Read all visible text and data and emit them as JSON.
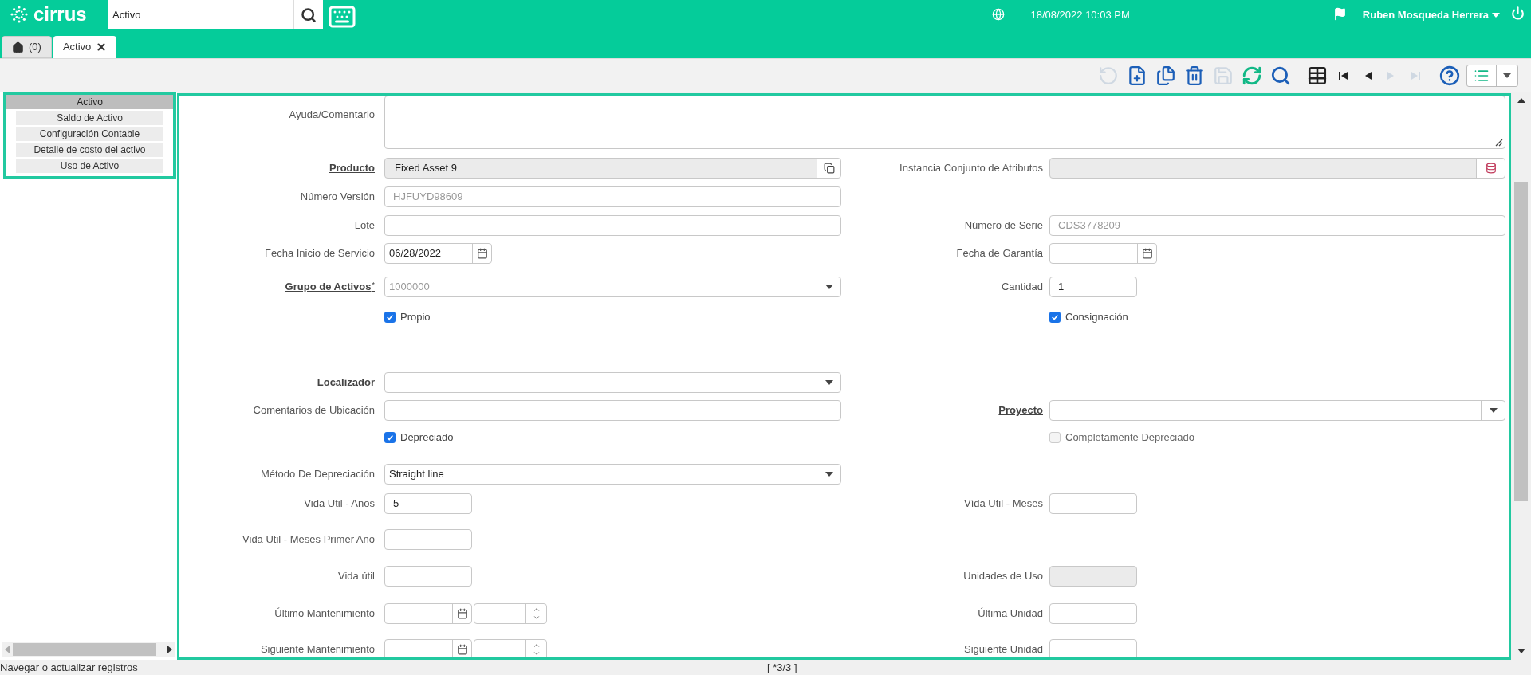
{
  "header": {
    "logo": "cirrus",
    "search": {
      "value": "Activo"
    },
    "datetime": "18/08/2022 10:03 PM",
    "user": "Ruben Mosqueda Herrera"
  },
  "tabs": [
    {
      "kind": "home",
      "label": "(0)",
      "selected": false
    },
    {
      "kind": "window",
      "label": "Activo",
      "selected": true
    }
  ],
  "toolbar": [
    {
      "kind": "undo",
      "disabled": true
    },
    {
      "kind": "new",
      "disabled": false
    },
    {
      "kind": "copy",
      "disabled": false
    },
    {
      "kind": "delete",
      "disabled": false
    },
    {
      "kind": "save",
      "disabled": true
    },
    {
      "kind": "refresh",
      "disabled": false
    },
    {
      "kind": "find",
      "disabled": false
    },
    {
      "kind": "grid",
      "disabled": false
    },
    {
      "kind": "first",
      "disabled": false
    },
    {
      "kind": "previous",
      "disabled": false
    },
    {
      "kind": "next",
      "disabled": true
    },
    {
      "kind": "last",
      "disabled": true
    },
    {
      "kind": "help",
      "disabled": false
    },
    {
      "kind": "menu",
      "disabled": false
    }
  ],
  "sidebar": {
    "title": "Activo",
    "items": [
      "Saldo de Activo",
      "Configuración Contable",
      "Detalle de costo del activo",
      "Uso de Activo"
    ]
  },
  "form": {
    "comment": {
      "label": "Ayuda/Comentario"
    },
    "rows": [
      {
        "left": {
          "kind": "lookup",
          "label": "Producto",
          "link": true,
          "readonly": true,
          "value": "Fixed Asset 9"
        },
        "right": {
          "kind": "attribute",
          "label": "Instancia Conjunto de Atributos",
          "readonly": true
        }
      },
      {
        "left": {
          "kind": "text",
          "label": "Número Versión",
          "dimmed": true,
          "value": "HJFUYD98609"
        }
      },
      {
        "left": {
          "kind": "text",
          "label": "Lote"
        },
        "right": {
          "kind": "text",
          "label": "Número de Serie",
          "dimmed": true,
          "value": "CDS3778209"
        }
      },
      {
        "left": {
          "kind": "date",
          "label": "Fecha Inicio de Servicio",
          "value": "06/28/2022"
        },
        "right": {
          "kind": "date",
          "label": "Fecha de Garantía"
        }
      },
      {
        "left": {
          "kind": "select",
          "label": "Grupo de Activos",
          "link": true,
          "mark": "*",
          "dimmed": true,
          "value": "1000000"
        },
        "right": {
          "kind": "number",
          "label": "Cantidad",
          "value": "1"
        }
      },
      {
        "left": {
          "kind": "checkbox",
          "label": "Propio",
          "checked": true
        },
        "right": {
          "kind": "checkbox",
          "label": "Consignación",
          "checked": true
        }
      },
      {
        "left": {
          "kind": "select",
          "label": "Localizador",
          "link": true
        }
      },
      {
        "left": {
          "kind": "text",
          "label": "Comentarios de Ubicación"
        },
        "right": {
          "kind": "select",
          "label": "Proyecto",
          "link": true
        }
      },
      {
        "left": {
          "kind": "checkbox",
          "label": "Depreciado",
          "checked": true
        },
        "right": {
          "kind": "checkbox",
          "label": "Completamente Depreciado",
          "checked": false,
          "disabled": true
        }
      },
      {
        "left": {
          "kind": "select",
          "label": "Método De Depreciación",
          "value": "Straight line"
        }
      },
      {
        "left": {
          "kind": "number",
          "label": "Vida Util - Años",
          "value": "5"
        },
        "right": {
          "kind": "number",
          "label": "Vída Util - Meses"
        }
      },
      {
        "left": {
          "kind": "number",
          "label": "Vida Util - Meses Primer Año"
        }
      },
      {
        "left": {
          "kind": "number",
          "label": "Vida útil"
        },
        "right": {
          "kind": "number",
          "label": "Unidades de Uso",
          "readonly": true
        }
      },
      {
        "left": {
          "kind": "datetime",
          "label": "Último Mantenimiento"
        },
        "right": {
          "kind": "number",
          "label": "Última Unidad"
        }
      },
      {
        "left": {
          "kind": "datetime",
          "label": "Siguiente Mantenimiento"
        },
        "right": {
          "kind": "number",
          "label": "Siguiente Unidad"
        }
      }
    ]
  },
  "status_bar": {
    "message": "Navegar o actualizar registros",
    "record": "[ *3/3 ]"
  }
}
